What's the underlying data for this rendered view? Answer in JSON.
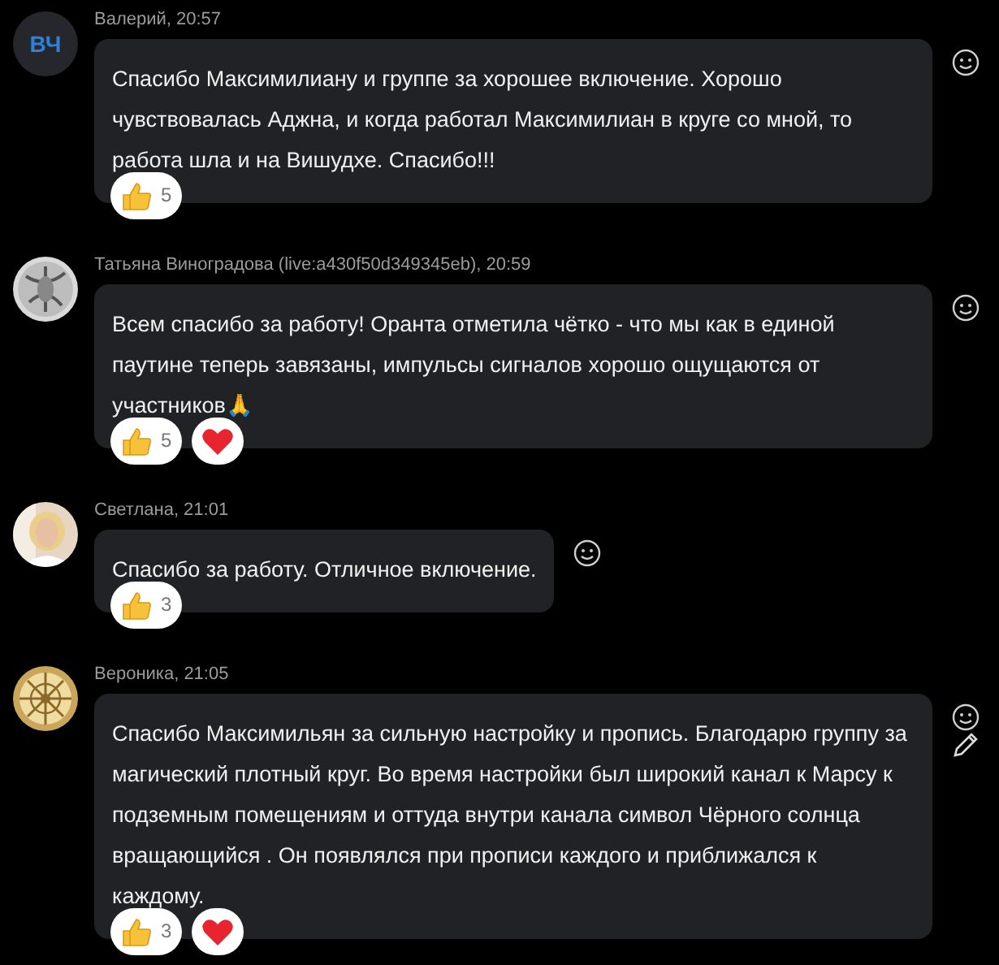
{
  "messages": [
    {
      "avatar": {
        "kind": "initials",
        "initials": "ВЧ"
      },
      "author": "Валерий, 20:57",
      "text": "Спасибо Максимилиану и группе за хорошее включение. Хорошо чувствовалась Аджна, и когда работал Максимилиан в круге со мной, то работа шла и на Вишудхе. Спасибо!!!",
      "editable": false,
      "reactions": [
        {
          "kind": "like",
          "count": "5"
        }
      ]
    },
    {
      "avatar": {
        "kind": "picture"
      },
      "author": "Татьяна Виноградова (live:a430f50d349345eb), 20:59",
      "text": "Всем спасибо за работу! Оранта отметила чётко - что мы как в единой паутине теперь завязаны, импульсы сигналов хорошо ощущаются от участников🙏",
      "editable": false,
      "reactions": [
        {
          "kind": "like",
          "count": "5"
        },
        {
          "kind": "heart"
        }
      ]
    },
    {
      "avatar": {
        "kind": "picture"
      },
      "author": "Светлана, 21:01",
      "text": "Спасибо за работу. Отличное включение.",
      "editable": false,
      "reactions": [
        {
          "kind": "like",
          "count": "3"
        }
      ]
    },
    {
      "avatar": {
        "kind": "picture"
      },
      "author": "Вероника, 21:05",
      "text": "Спасибо Максимильян за сильную настройку и пропись. Благодарю группу за магический плотный  круг. Во время настройки был широкий канал к Марсу к подземным помещениям и оттуда внутри канала символ Чёрного солнца вращающийся . Он появлялся при прописи каждого и приближался к каждому.",
      "editable": true,
      "reactions": [
        {
          "kind": "like",
          "count": "3"
        },
        {
          "kind": "heart"
        }
      ]
    }
  ]
}
